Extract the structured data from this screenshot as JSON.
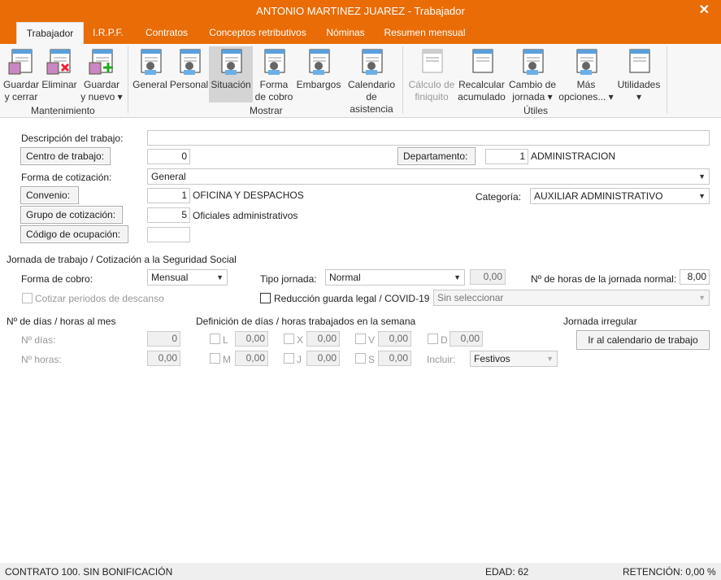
{
  "window": {
    "title": "ANTONIO MARTINEZ JUAREZ - Trabajador",
    "close_icon": "close-icon"
  },
  "tabs": [
    "Trabajador",
    "I.R.P.F.",
    "Contratos",
    "Conceptos retributivos",
    "Nóminas",
    "Resumen mensual"
  ],
  "ribbon": {
    "groups": {
      "mantenimiento": "Mantenimiento",
      "mostrar": "Mostrar",
      "utiles": "Útiles"
    },
    "buttons": [
      {
        "l1": "Guardar",
        "l2": "y cerrar",
        "icon": "save-close-icon"
      },
      {
        "l1": "Eliminar",
        "l2": "",
        "icon": "delete-icon"
      },
      {
        "l1": "Guardar",
        "l2": "y nuevo ▾",
        "icon": "save-new-icon"
      },
      {
        "l1": "General",
        "l2": "",
        "icon": "general-icon"
      },
      {
        "l1": "Personal",
        "l2": "",
        "icon": "personal-icon"
      },
      {
        "l1": "Situación",
        "l2": "",
        "icon": "situation-icon",
        "selected": true
      },
      {
        "l1": "Forma",
        "l2": "de cobro",
        "icon": "payment-icon"
      },
      {
        "l1": "Embargos",
        "l2": "",
        "icon": "embargo-icon"
      },
      {
        "l1": "Calendario",
        "l2": "de asistencia",
        "icon": "calendar-icon"
      },
      {
        "l1": "Cálculo de",
        "l2": "finiquito",
        "icon": "settlement-icon",
        "disabled": true
      },
      {
        "l1": "Recalcular",
        "l2": "acumulado",
        "icon": "sum-icon"
      },
      {
        "l1": "Cambio de",
        "l2": "jornada ▾",
        "icon": "shift-change-icon"
      },
      {
        "l1": "Más",
        "l2": "opciones... ▾",
        "icon": "more-options-icon"
      },
      {
        "l1": "Utilidades",
        "l2": "▾",
        "icon": "calculator-icon"
      }
    ]
  },
  "form": {
    "descripcion_label": "Descripción del trabajo:",
    "descripcion_value": "",
    "centro_btn": "Centro de trabajo:",
    "centro_value": "0",
    "departamento_btn": "Departamento:",
    "departamento_value": "1",
    "departamento_name": "ADMINISTRACION",
    "forma_cotizacion_label": "Forma de cotización:",
    "forma_cotizacion_value": "General",
    "convenio_btn": "Convenio:",
    "convenio_value": "1",
    "convenio_name": "OFICINA Y DESPACHOS",
    "categoria_label": "Categoría:",
    "categoria_value": "AUXILIAR ADMINISTRATIVO",
    "grupo_btn": "Grupo de cotización:",
    "grupo_value": "5",
    "grupo_name": "Oficiales administrativos",
    "codigo_btn": "Código de ocupación:",
    "codigo_value": ""
  },
  "jornada": {
    "section": "Jornada de trabajo / Cotización a la Seguridad Social",
    "forma_cobro_label": "Forma de cobro:",
    "forma_cobro_value": "Mensual",
    "tipo_label": "Tipo jornada:",
    "tipo_value": "Normal",
    "tipo_extra": "0,00",
    "horas_label": "Nº de horas de la jornada normal:",
    "horas_value": "8,00",
    "cotizar_label": "Cotizar periodos de descanso",
    "reduccion_label": "Reducción guarda legal / COVID-19",
    "reduccion_value": "Sin seleccionar"
  },
  "mes": {
    "section": "Nº de días / horas al mes",
    "dias_label": "Nº días:",
    "dias_value": "0",
    "horas_label": "Nº horas:",
    "horas_value": "0,00"
  },
  "semana": {
    "section": "Definición de días / horas trabajados en la semana",
    "days": [
      {
        "d": "L",
        "v": "0,00"
      },
      {
        "d": "X",
        "v": "0,00"
      },
      {
        "d": "V",
        "v": "0,00"
      },
      {
        "d": "D",
        "v": "0,00"
      },
      {
        "d": "M",
        "v": "0,00"
      },
      {
        "d": "J",
        "v": "0,00"
      },
      {
        "d": "S",
        "v": "0,00"
      }
    ],
    "incluir_label": "Incluir:",
    "incluir_value": "Festivos"
  },
  "irregular": {
    "section": "Jornada irregular",
    "button": "Ir al calendario de trabajo"
  },
  "status": {
    "contrato": "CONTRATO 100.  SIN BONIFICACIÓN",
    "edad": "EDAD: 62",
    "retencion": "RETENCIÓN: 0,00 %"
  }
}
